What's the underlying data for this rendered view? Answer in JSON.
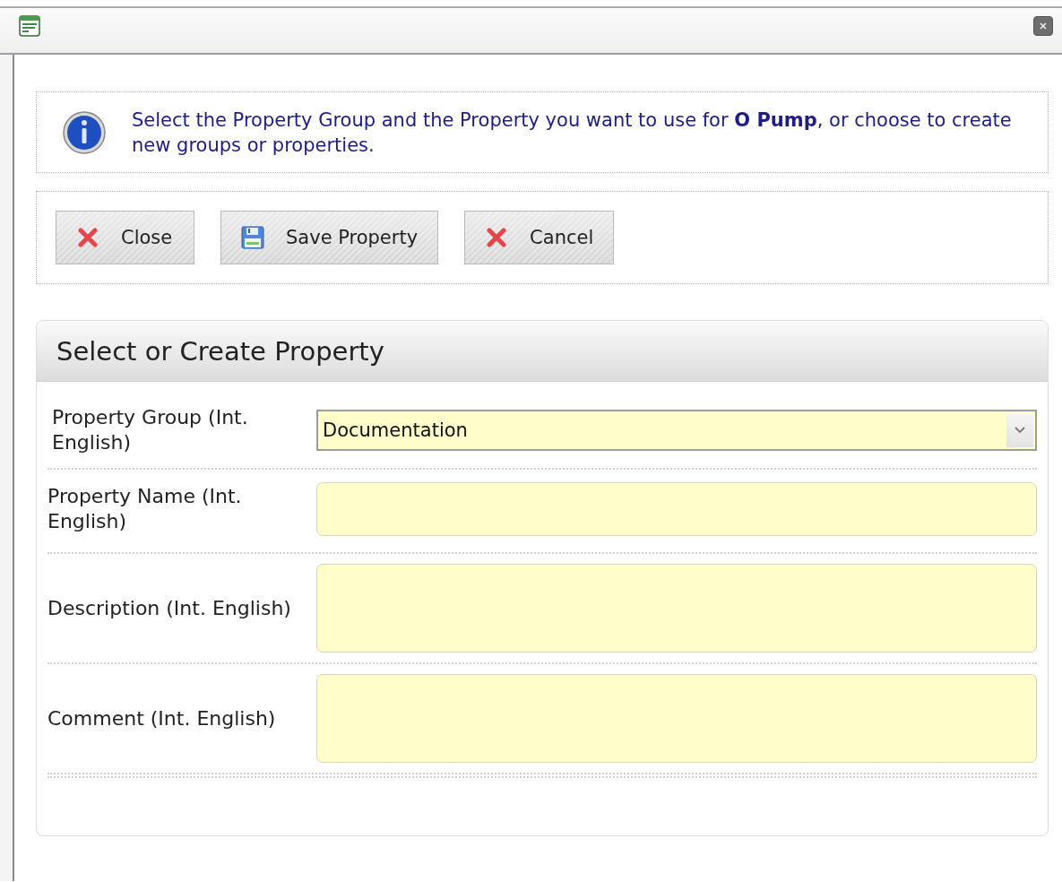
{
  "info": {
    "message": "Select the Property Group and the Property you want to use for **O Pump**, or choose to create new groups or properties."
  },
  "toolbar": {
    "buttons": [
      {
        "label": "Close",
        "kind": "close"
      },
      {
        "label": "Save Property",
        "kind": "save"
      },
      {
        "label": "Cancel",
        "kind": "cancel"
      }
    ]
  },
  "panel": {
    "title": "Select or Create Property",
    "fields": [
      {
        "label": "Property Group (Int. English)",
        "kind": "select",
        "value": "Documentation"
      },
      {
        "label": "Property Name (Int. English)",
        "kind": "text"
      },
      {
        "label": "Description (Int. English)",
        "kind": "textarea"
      },
      {
        "label": "Comment (Int. English)",
        "kind": "textarea"
      }
    ]
  }
}
